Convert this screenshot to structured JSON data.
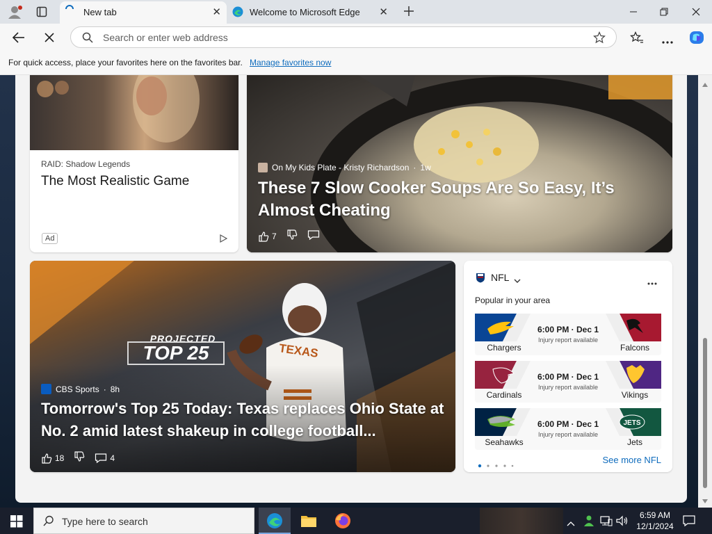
{
  "tabs": [
    {
      "label": "New tab",
      "active": true
    },
    {
      "label": "Welcome to Microsoft Edge",
      "active": false
    }
  ],
  "address_bar": {
    "placeholder": "Search or enter web address",
    "value": ""
  },
  "favorites_bar": {
    "message": "For quick access, place your favorites here on the favorites bar.",
    "link": "Manage favorites now"
  },
  "cards": {
    "ad": {
      "sponsor": "RAID: Shadow Legends",
      "title": "The Most Realistic Game",
      "badge": "Ad"
    },
    "soup": {
      "source": "On My Kids Plate - Kristy Richardson",
      "age": "1w",
      "title": "These 7 Slow Cooker Soups Are So Easy, It’s Almost Cheating",
      "likes": "7"
    },
    "football": {
      "overlay_line1": "PROJECTED",
      "overlay_line2": "TOP 25",
      "jersey": "TEXAS",
      "source": "CBS Sports",
      "age": "8h",
      "title": "Tomorrow's Top 25 Today: Texas replaces Ohio State at No. 2 amid latest shakeup in college football...",
      "likes": "18",
      "comments": "4"
    }
  },
  "nfl_widget": {
    "league": "NFL",
    "subtitle": "Popular in your area",
    "games": [
      {
        "time": "6:00 PM · Dec 1",
        "note": "Injury report available",
        "home": "Chargers",
        "away": "Falcons",
        "home_color": "#0a4595",
        "away_color": "#a71930"
      },
      {
        "time": "6:00 PM · Dec 1",
        "note": "Injury report available",
        "home": "Cardinals",
        "away": "Vikings",
        "home_color": "#97233f",
        "away_color": "#4f2683"
      },
      {
        "time": "6:00 PM · Dec 1",
        "note": "Injury report available",
        "home": "Seahawks",
        "away": "Jets",
        "home_color": "#002244",
        "away_color": "#125740"
      }
    ],
    "see_more": "See more NFL"
  },
  "taskbar": {
    "search_placeholder": "Type here to search",
    "time": "6:59 AM",
    "date": "12/1/2024"
  }
}
